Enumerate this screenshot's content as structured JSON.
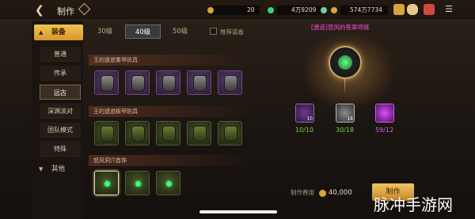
{
  "header": {
    "back_icon": "arrow-left-icon",
    "title": "制作",
    "currency1": "20",
    "currency2": "4万9209",
    "currency3": "574万7734",
    "colors": {
      "gold": "#d8a43c",
      "accent": "#f0c461"
    }
  },
  "sidebar": {
    "category": "装备",
    "items": [
      "普通",
      "传承",
      "远古",
      "深渊派对",
      "团队模式",
      "特殊"
    ],
    "active_index": 2,
    "other": "其他"
  },
  "level_tabs": [
    "30级",
    "40级",
    "50级"
  ],
  "active_level_index": 1,
  "recommend_label": "推荐装备",
  "groups": [
    {
      "title": "王的遗迹重甲防具"
    },
    {
      "title": "王的遗迹板甲防具"
    },
    {
      "title": "怒风洞穴首饰"
    }
  ],
  "craft": {
    "item_label": "[遗迹]怒风的苍翠项链",
    "materials": [
      {
        "badge": "10",
        "count": "10/10"
      },
      {
        "badge": "18",
        "count": "30/18"
      },
      {
        "badge": "",
        "count": "59/12"
      }
    ],
    "cost_label": "制作费用",
    "cost_value": "40,000",
    "button_label": "制作"
  },
  "watermark": "脉冲手游网"
}
